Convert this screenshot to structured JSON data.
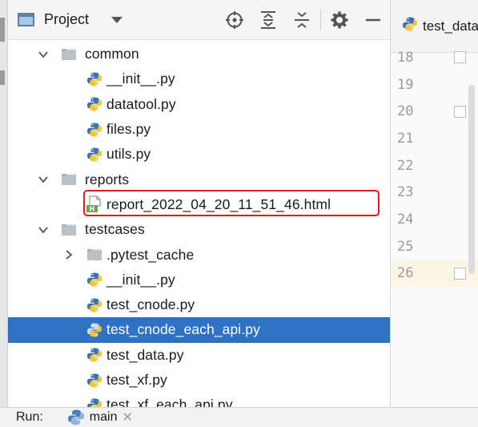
{
  "panel": {
    "title": "Project",
    "toolbar_icons": [
      "locate-icon",
      "expand-all-icon",
      "collapse-all-icon",
      "settings-icon",
      "hide-icon"
    ]
  },
  "tree": [
    {
      "label": "common",
      "kind": "folder",
      "depth": 1,
      "arrow": "down"
    },
    {
      "label": "__init__.py",
      "kind": "python",
      "depth": 2
    },
    {
      "label": "datatool.py",
      "kind": "python",
      "depth": 2
    },
    {
      "label": "files.py",
      "kind": "python",
      "depth": 2
    },
    {
      "label": "utils.py",
      "kind": "python",
      "depth": 2
    },
    {
      "label": "reports",
      "kind": "folder",
      "depth": 1,
      "arrow": "down"
    },
    {
      "label": "report_2022_04_20_11_51_46.html",
      "kind": "html",
      "depth": 2
    },
    {
      "label": "testcases",
      "kind": "folder",
      "depth": 1,
      "arrow": "down"
    },
    {
      "label": ".pytest_cache",
      "kind": "folder",
      "depth": 2,
      "arrow": "right"
    },
    {
      "label": "__init__.py",
      "kind": "python",
      "depth": 2
    },
    {
      "label": "test_cnode.py",
      "kind": "python",
      "depth": 2
    },
    {
      "label": "test_cnode_each_api.py",
      "kind": "python",
      "depth": 2,
      "selected": true
    },
    {
      "label": "test_data.py",
      "kind": "python",
      "depth": 2
    },
    {
      "label": "test_xf.py",
      "kind": "python",
      "depth": 2
    },
    {
      "label": "test_xf_each_api.py",
      "kind": "python",
      "depth": 2
    }
  ],
  "editor": {
    "tab_label": "test_data",
    "line_numbers": [
      "18",
      "19",
      "20",
      "21",
      "22",
      "23",
      "24",
      "25",
      "26"
    ],
    "current_line": "26"
  },
  "status": {
    "run_label": "Run:",
    "config_name": "main",
    "close_glyph": "✕"
  },
  "colors": {
    "selection": "#2f72c4",
    "highlight_box": "#e01b24",
    "python_blue": "#3a72b0",
    "python_yellow": "#f2c43a",
    "folder": "#a9b3bd",
    "html_badge": "#6aa84f"
  }
}
